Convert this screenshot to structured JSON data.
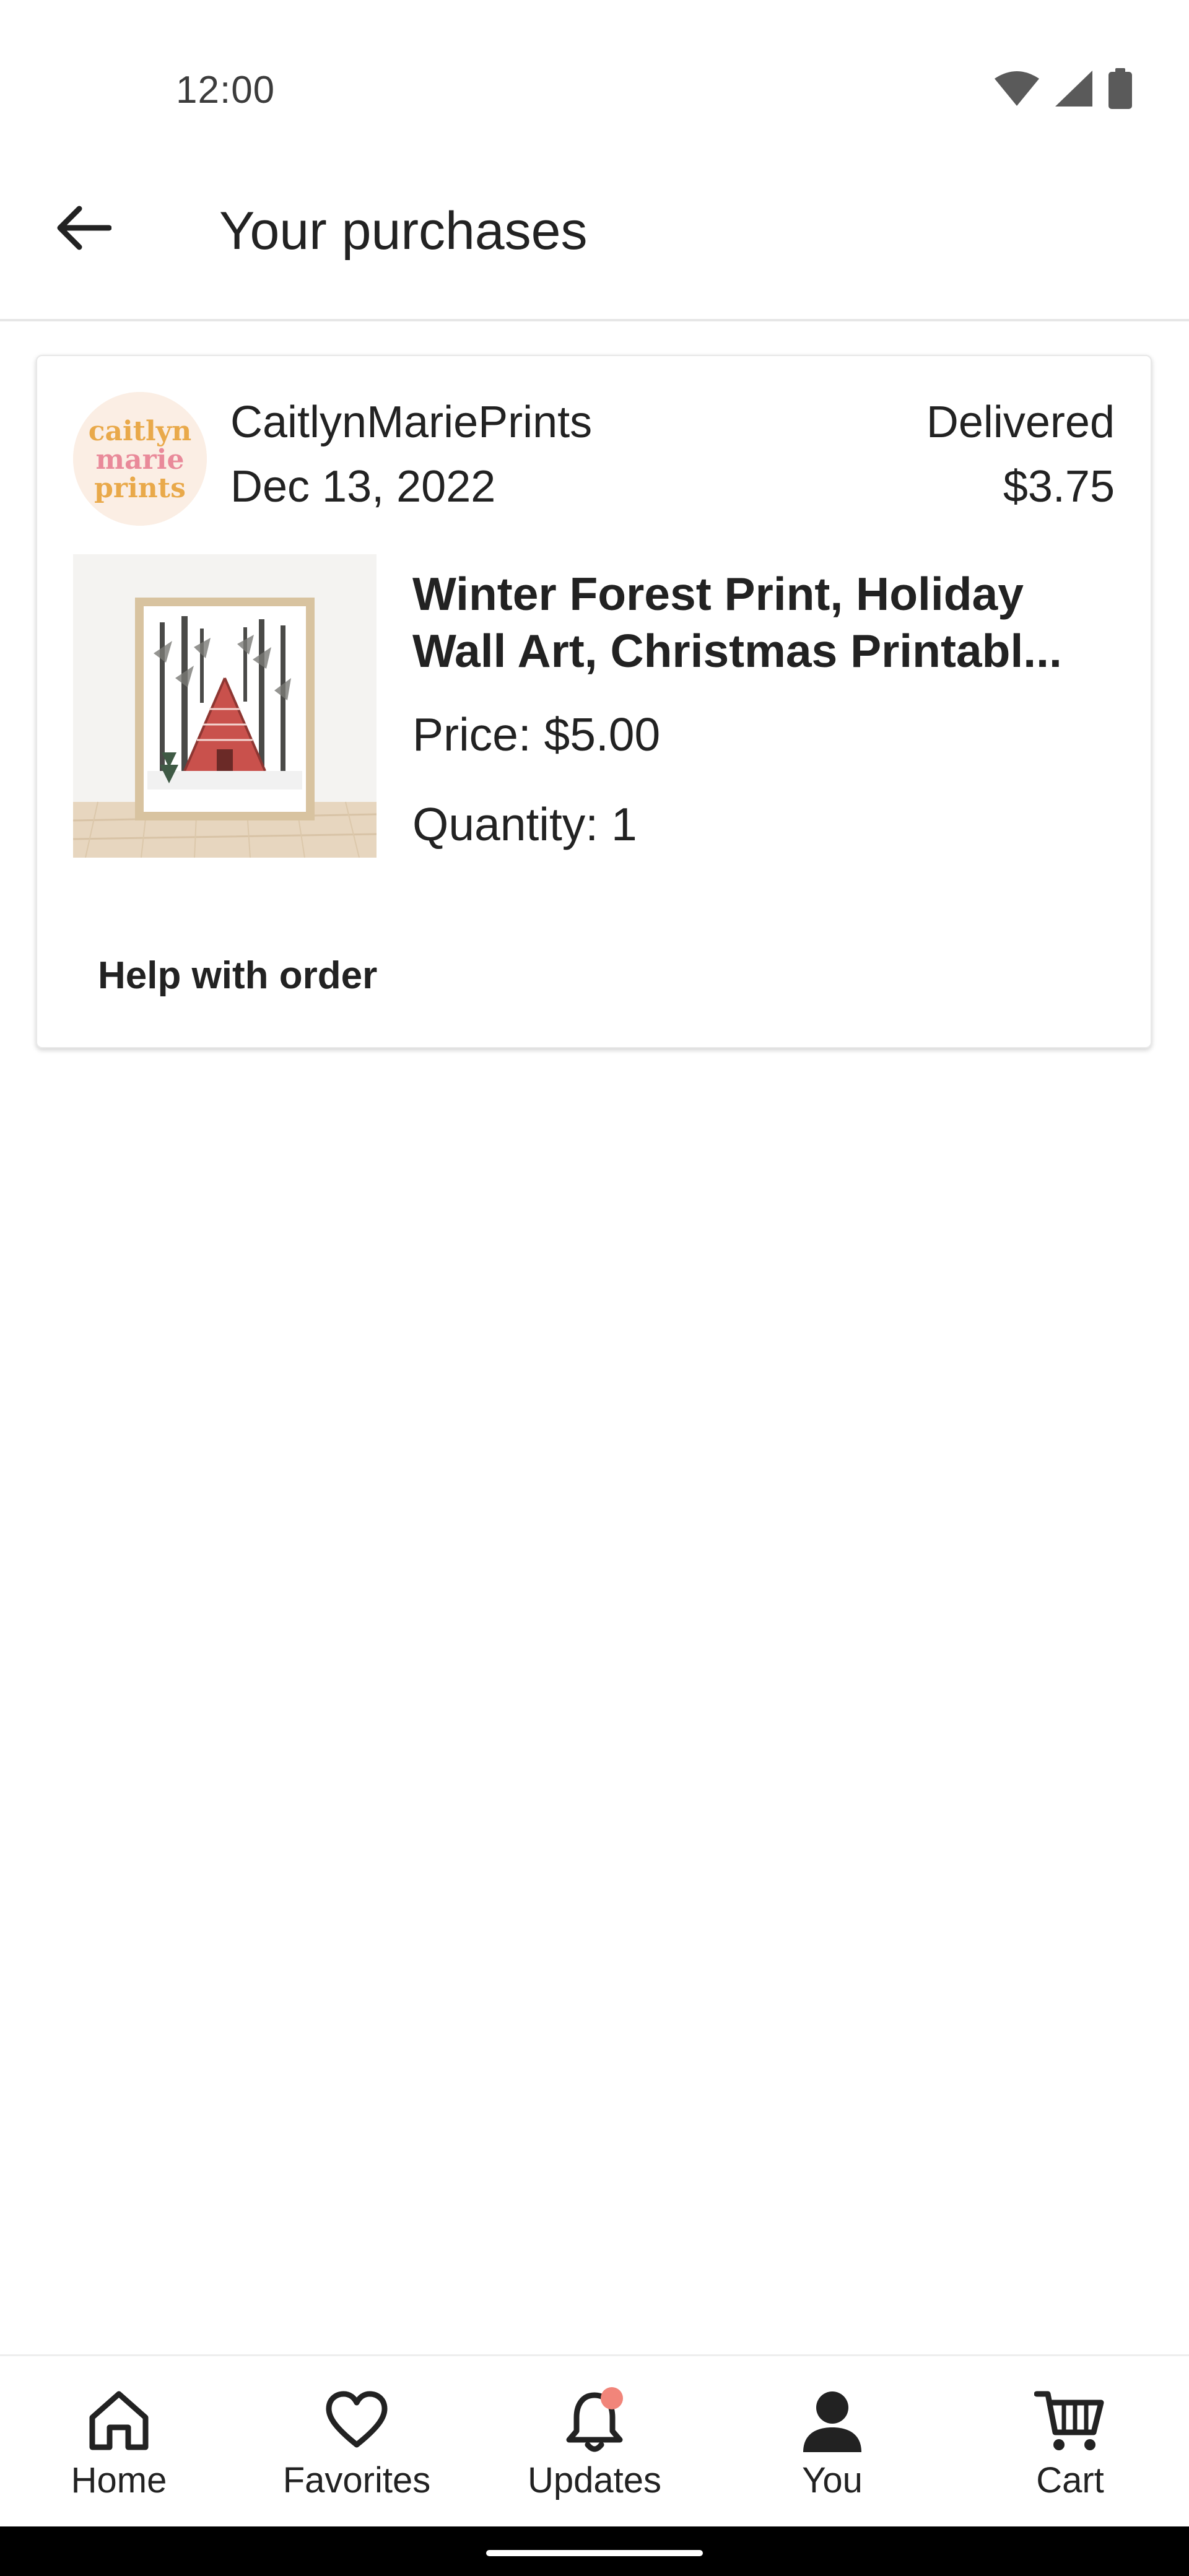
{
  "status_bar": {
    "time": "12:00",
    "icons": [
      "wifi-icon",
      "signal-icon",
      "battery-icon"
    ]
  },
  "app_bar": {
    "back_icon": "arrow-left-icon",
    "title": "Your purchases"
  },
  "order": {
    "shop_name": "CaitlynMariePrints",
    "shop_logo_text": [
      "caitlyn",
      "marie",
      "prints"
    ],
    "date": "Dec 13, 2022",
    "status": "Delivered",
    "total": "$3.75",
    "item": {
      "title": "Winter Forest Print, Holiday Wall Art, Christmas Printabl...",
      "price": "Price: $5.00",
      "quantity": "Quantity: 1"
    },
    "help_label": "Help with order"
  },
  "bottom_nav": {
    "items": [
      {
        "label": "Home",
        "icon": "home-icon"
      },
      {
        "label": "Favorites",
        "icon": "heart-icon"
      },
      {
        "label": "Updates",
        "icon": "bell-icon",
        "has_notification": true
      },
      {
        "label": "You",
        "icon": "person-icon"
      },
      {
        "label": "Cart",
        "icon": "cart-icon"
      }
    ]
  },
  "colors": {
    "notification_dot": "#f1857a",
    "text": "#222222",
    "logo_pink": "#e98a9a",
    "logo_orange": "#e9a94a"
  }
}
